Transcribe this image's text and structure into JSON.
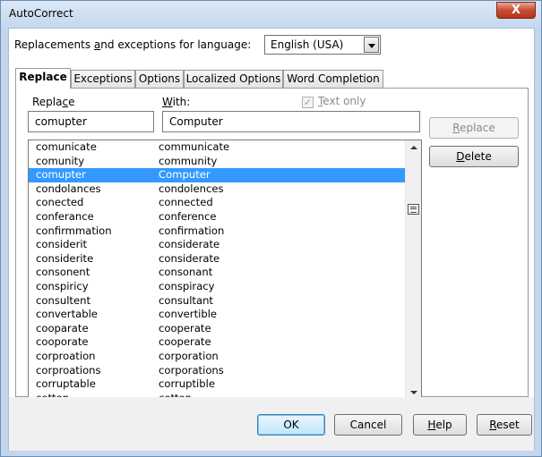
{
  "window": {
    "title": "AutoCorrect",
    "close_glyph": "X"
  },
  "language": {
    "label_pre": "Replacements ",
    "label_accel": "a",
    "label_post": "nd exceptions for language:",
    "selected": "English (USA)"
  },
  "tabs": [
    {
      "label": "Replace",
      "active": true
    },
    {
      "label": "Exceptions"
    },
    {
      "label": "Options"
    },
    {
      "label": "Localized Options"
    },
    {
      "label": "Word Completion"
    }
  ],
  "replace_tab": {
    "replace_label_pre": "Repla",
    "replace_label_accel": "c",
    "replace_label_post": "e",
    "with_label_accel": "W",
    "with_label_post": "ith:",
    "text_only_accel": "T",
    "text_only_post": "ext only",
    "text_only_checked": true,
    "replace_value": "comupter",
    "with_value": "Computer",
    "replace_button_accel": "R",
    "replace_button_post": "eplace",
    "delete_button_accel": "D",
    "delete_button_post": "elete"
  },
  "entries": [
    {
      "replace": "comunicate",
      "with": "communicate"
    },
    {
      "replace": "comunity",
      "with": "community"
    },
    {
      "replace": "comupter",
      "with": "Computer",
      "selected": true
    },
    {
      "replace": "condolances",
      "with": "condolences"
    },
    {
      "replace": "conected",
      "with": "connected"
    },
    {
      "replace": "conferance",
      "with": "conference"
    },
    {
      "replace": "confirmmation",
      "with": "confirmation"
    },
    {
      "replace": "considerit",
      "with": "considerate"
    },
    {
      "replace": "considerite",
      "with": "considerate"
    },
    {
      "replace": "consonent",
      "with": "consonant"
    },
    {
      "replace": "conspiricy",
      "with": "conspiracy"
    },
    {
      "replace": "consultent",
      "with": "consultant"
    },
    {
      "replace": "convertable",
      "with": "convertible"
    },
    {
      "replace": "cooparate",
      "with": "cooperate"
    },
    {
      "replace": "cooporate",
      "with": "cooperate"
    },
    {
      "replace": "corproation",
      "with": "corporation"
    },
    {
      "replace": "corproations",
      "with": "corporations"
    },
    {
      "replace": "corruptable",
      "with": "corruptible"
    },
    {
      "replace": "cotten",
      "with": "cotton"
    }
  ],
  "footer": {
    "ok_label": "OK",
    "cancel_label": "Cancel",
    "help_accel": "H",
    "help_post": "elp",
    "reset_accel": "R",
    "reset_post": "eset"
  },
  "colors": {
    "selection": "#3399ff",
    "frame": "#c3d6ec",
    "close_button": "#c74c31"
  }
}
